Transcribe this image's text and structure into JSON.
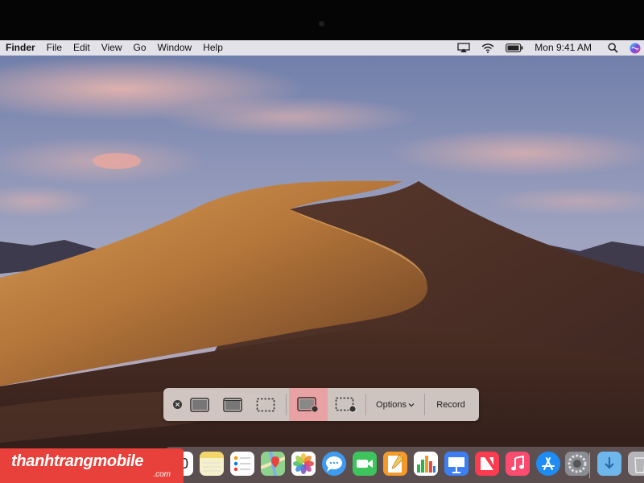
{
  "menubar": {
    "app_name": "Finder",
    "items": [
      "File",
      "Edit",
      "View",
      "Go",
      "Window",
      "Help"
    ],
    "status_icons": [
      "airplay-icon",
      "wifi-icon",
      "battery-icon"
    ],
    "clock": "Mon 9:41 AM",
    "right_icons": [
      "spotlight-search-icon",
      "siri-icon"
    ]
  },
  "screenshot_toolbar": {
    "tools": [
      {
        "name": "close-icon"
      },
      {
        "name": "capture-entire-screen-icon"
      },
      {
        "name": "capture-window-icon"
      },
      {
        "name": "capture-selection-icon"
      },
      {
        "name": "record-entire-screen-icon",
        "selected": true
      },
      {
        "name": "record-selection-icon"
      }
    ],
    "options_label": "Options",
    "record_label": "Record",
    "selected_color": "#e8a2a3"
  },
  "dock": {
    "apps": [
      "calendar-icon",
      "notes-icon",
      "reminders-icon",
      "maps-icon",
      "photos-icon",
      "messages-icon",
      "facetime-icon",
      "pages-icon",
      "numbers-icon",
      "keynote-icon",
      "news-icon",
      "music-icon",
      "app-store-icon",
      "system-preferences-icon",
      "downloads-folder-icon",
      "trash-icon"
    ],
    "calendar_day": "0"
  },
  "watermark": {
    "name": "thanhtrangmobile",
    "domain": ".com",
    "color": "#e8403a"
  }
}
